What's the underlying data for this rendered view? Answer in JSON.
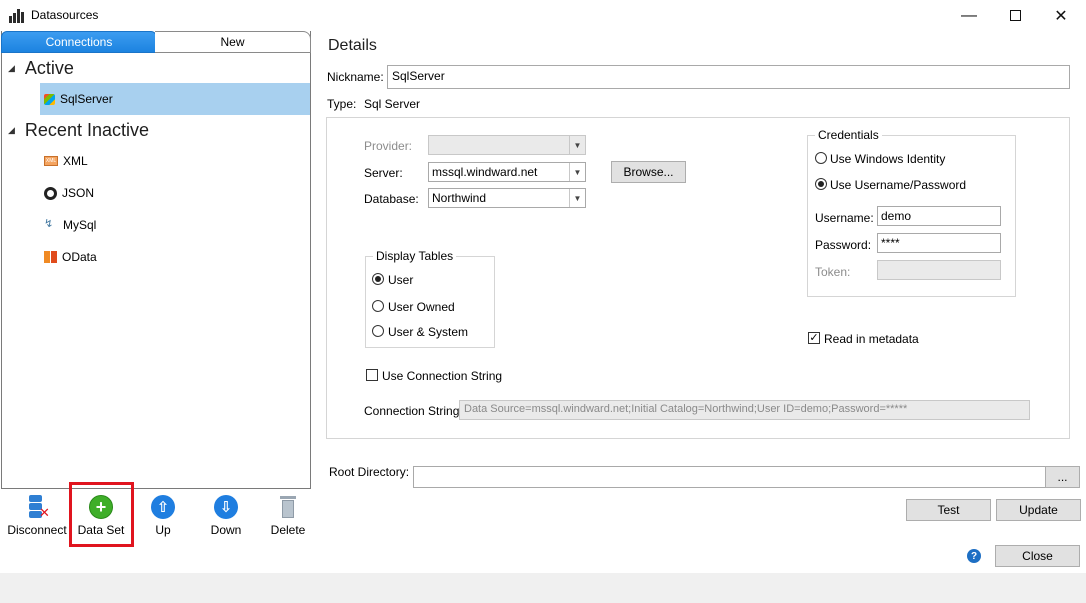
{
  "window": {
    "title": "Datasources",
    "app_icon": "bar-chart-icon",
    "minimize_icon": "minimize-icon",
    "maximize_icon": "maximize-icon",
    "close_icon": "close-icon"
  },
  "left": {
    "tabs": [
      {
        "label": "Connections"
      },
      {
        "label": "New"
      }
    ],
    "groups": {
      "active": {
        "label": "Active",
        "items": [
          {
            "label": "SqlServer",
            "icon": "sqlserver-icon"
          }
        ]
      },
      "recent": {
        "label": "Recent Inactive",
        "items": [
          {
            "label": "XML",
            "icon": "xml-icon"
          },
          {
            "label": "JSON",
            "icon": "json-icon"
          },
          {
            "label": "MySql",
            "icon": "mysql-icon"
          },
          {
            "label": "OData",
            "icon": "odata-icon"
          }
        ]
      }
    },
    "toolbar": {
      "disconnect": "Disconnect",
      "dataset": "Data Set",
      "up": "Up",
      "down": "Down",
      "delete": "Delete"
    }
  },
  "details": {
    "title": "Details",
    "nickname_label": "Nickname:",
    "nickname_value": "SqlServer",
    "type_label": "Type:",
    "type_value": "Sql Server",
    "provider_label": "Provider:",
    "server_label": "Server:",
    "server_value": "mssql.windward.net",
    "database_label": "Database:",
    "database_value": "Northwind",
    "browse_label": "Browse...",
    "display_tables": {
      "legend": "Display Tables",
      "options": [
        "User",
        "User Owned",
        "User & System"
      ],
      "selected": "User"
    },
    "credentials": {
      "legend": "Credentials",
      "windows_identity": "Use Windows Identity",
      "username_password": "Use Username/Password",
      "username_label": "Username:",
      "username_value": "demo",
      "password_label": "Password:",
      "password_value": "****",
      "token_label": "Token:"
    },
    "read_metadata_label": "Read in metadata",
    "use_connection_string_label": "Use Connection String",
    "connection_string_label": "Connection String:",
    "connection_string_value": "Data Source=mssql.windward.net;Initial Catalog=Northwind;User ID=demo;Password=*****",
    "root_directory_label": "Root Directory:",
    "root_browse_label": "...",
    "test_label": "Test",
    "update_label": "Update",
    "close_label": "Close",
    "help_glyph": "?"
  }
}
